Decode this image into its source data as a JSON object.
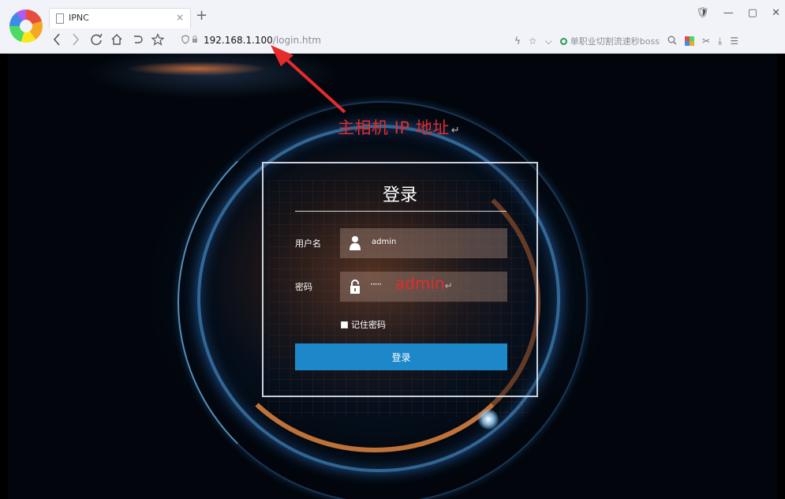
{
  "browser": {
    "tab_title": "IPNC",
    "tab_close": "×",
    "new_tab": "+",
    "window_controls": [
      "🛡",
      "—",
      "▢",
      "✕"
    ],
    "nav_icons": [
      "chevron-left-icon",
      "chevron-right-icon",
      "refresh-icon",
      "home-icon",
      "undo-icon",
      "star-icon"
    ],
    "address_host": "192.168.1.100",
    "address_path": "/login.htm",
    "search_hint": "单职业切割流速秒boss"
  },
  "annotations": {
    "ip_label": "主相机 IP 地址",
    "ip_pilcrow": "↵",
    "password_label": "admin",
    "password_pilcrow": "↵",
    "color": "#e52b2b"
  },
  "login": {
    "title": "登录",
    "username_label": "用户名",
    "username_value": "admin",
    "password_label": "密码",
    "password_mask": "·····",
    "remember_label": "记住密码",
    "submit_label": "登录",
    "submit_color": "#1c87c9"
  }
}
